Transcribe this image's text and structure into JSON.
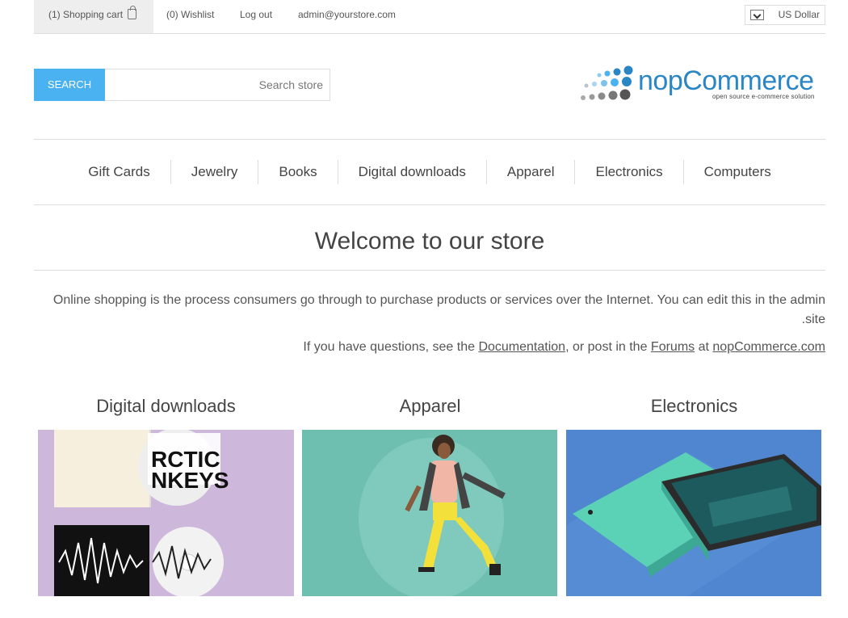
{
  "header": {
    "cart_label": "(1) Shopping cart",
    "wishlist_label": "(0) Wishlist",
    "logout_label": "Log out",
    "account_email": "admin@yourstore.com",
    "currency": "US Dollar"
  },
  "search": {
    "button_label": "SEARCH",
    "placeholder": "Search store"
  },
  "logo": {
    "name": "nopCommerce",
    "tagline": "open source e-commerce solution"
  },
  "menu": [
    "Gift Cards",
    "Jewelry",
    "Books",
    "Digital downloads",
    "Apparel",
    "Electronics",
    "Computers"
  ],
  "welcome": {
    "title": "Welcome to our store",
    "text": "Online shopping is the process consumers go through to purchase products or services over the Internet. You can edit this in the admin site.",
    "help_prefix": "If you have questions, see the ",
    "doc_link": "Documentation",
    "help_middle": ", or post in the ",
    "forum_link": "Forums",
    "help_at": " at ",
    "site_link": "nopCommerce.com"
  },
  "categories": [
    {
      "title": "Digital downloads",
      "image": "album-covers-image"
    },
    {
      "title": "Apparel",
      "image": "jumping-woman-image"
    },
    {
      "title": "Electronics",
      "image": "smartphone-image"
    }
  ],
  "colors": {
    "accent": "#4ab2f1",
    "logo_blue": "#2b86c5"
  }
}
